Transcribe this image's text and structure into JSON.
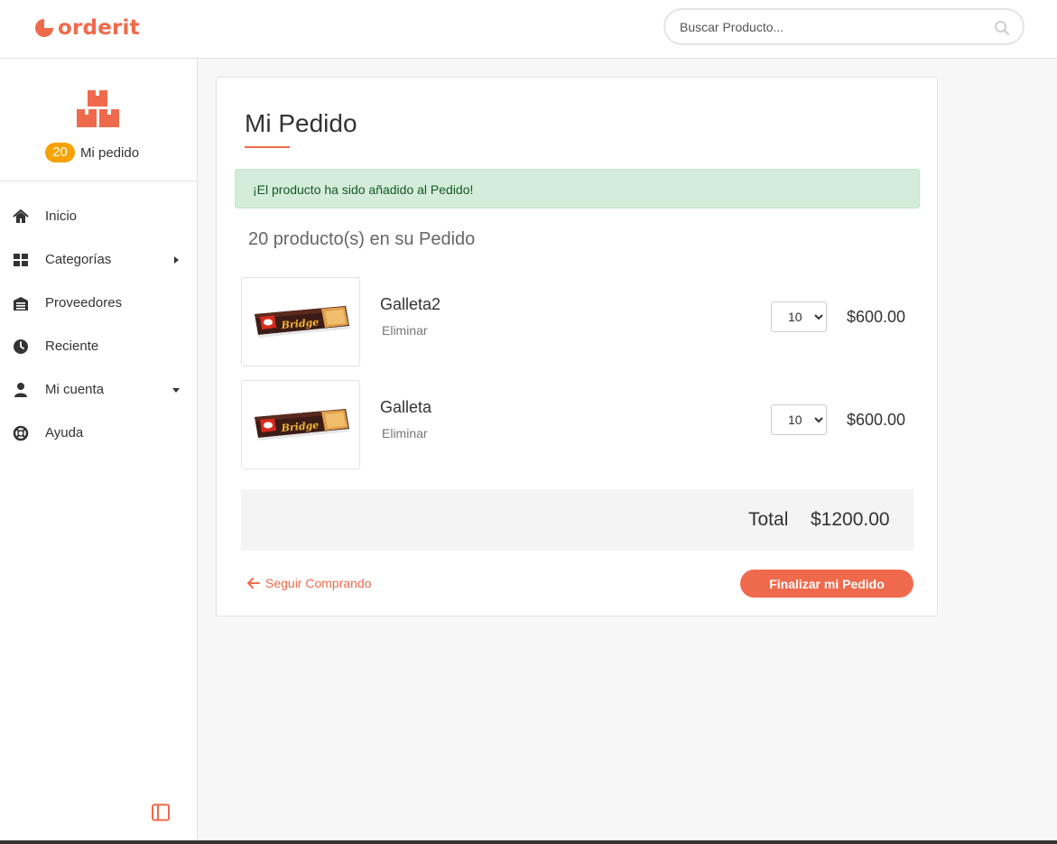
{
  "brand": {
    "name": "orderit",
    "accent": "#ef6a4c"
  },
  "search": {
    "placeholder": "Buscar Producto...",
    "icon": "search-icon"
  },
  "sidebar": {
    "order_count": "20",
    "order_label": "Mi pedido",
    "items": [
      {
        "label": "Inicio",
        "icon": "home-icon"
      },
      {
        "label": "Categorías",
        "icon": "grid-icon",
        "caret": "caret-right-icon"
      },
      {
        "label": "Proveedores",
        "icon": "warehouse-icon"
      },
      {
        "label": "Reciente",
        "icon": "clock-icon"
      },
      {
        "label": "Mi cuenta",
        "icon": "user-icon",
        "caret": "caret-down-icon"
      },
      {
        "label": "Ayuda",
        "icon": "lifebuoy-icon"
      }
    ],
    "collapse_icon": "sidebar-toggle-icon"
  },
  "main": {
    "title": "Mi Pedido",
    "alert": "¡El producto ha sido añadido al Pedido!",
    "count_line": "20 producto(s) en su Pedido",
    "items": [
      {
        "name": "Galleta2",
        "remove": "Eliminar",
        "qty": "10",
        "price": "$600.00"
      },
      {
        "name": "Galleta",
        "remove": "Eliminar",
        "qty": "10",
        "price": "$600.00"
      }
    ],
    "total_label": "Total",
    "total_value": "$1200.00",
    "continue_label": "Seguir Comprando",
    "finish_label": "Finalizar mi Pedido"
  }
}
